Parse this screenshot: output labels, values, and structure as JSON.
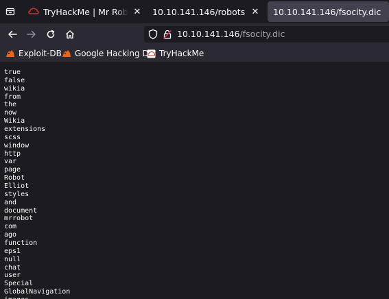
{
  "tabs": [
    {
      "title": "TryHackMe | Mr Robot CTF",
      "active": false
    },
    {
      "title": "10.10.141.146/robots",
      "active": false
    },
    {
      "title": "10.10.141.146/fsocity.dic",
      "active": true
    }
  ],
  "urlbar": {
    "host": "10.10.141.146",
    "path": "/fsocity.dic"
  },
  "bookmarks": [
    {
      "label": "Exploit-DB",
      "icon": "exploit-db-icon"
    },
    {
      "label": "Google Hacking DB",
      "icon": "ghdb-icon"
    },
    {
      "label": "TryHackMe",
      "icon": "tryhackme-icon"
    }
  ],
  "colors": {
    "tab_strip_bg": "#1c1b22",
    "toolbar_bg": "#2b2a33",
    "active_tab_bg": "#42414d",
    "content_bg": "#1c1b22",
    "text": "#fbfbfe",
    "exploit_db_orange": "#e8651b",
    "tryhackme_red": "#c0392b"
  },
  "words": [
    "true",
    "false",
    "wikia",
    "from",
    "the",
    "now",
    "Wikia",
    "extensions",
    "scss",
    "window",
    "http",
    "var",
    "page",
    "Robot",
    "Elliot",
    "styles",
    "and",
    "document",
    "mrrobot",
    "com",
    "ago",
    "function",
    "eps1",
    "null",
    "chat",
    "user",
    "Special",
    "GlobalNavigation",
    "images"
  ]
}
